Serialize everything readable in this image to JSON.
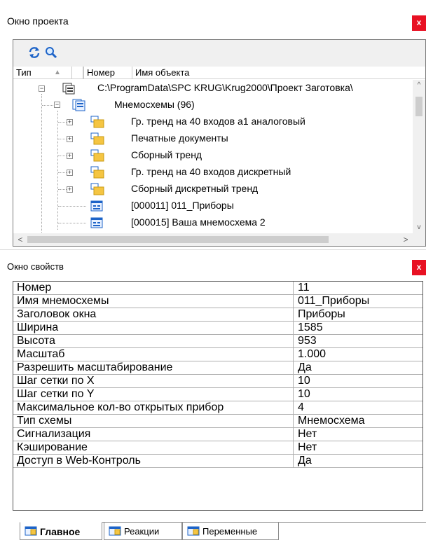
{
  "project_window": {
    "title": "Окно проекта",
    "close_label": "x",
    "columns": {
      "type": "Тип",
      "number": "Номер",
      "name": "Имя объекта"
    },
    "tree": {
      "root": {
        "label": "C:\\ProgramData\\SPC KRUG\\Krug2000\\Проект Заготовка\\"
      },
      "group": {
        "label": "Мнемосхемы (96)"
      },
      "folders": [
        {
          "label": "Гр. тренд на 40 входов а1 аналоговый"
        },
        {
          "label": "Печатные документы"
        },
        {
          "label": "Сборный тренд"
        },
        {
          "label": "Гр. тренд на 40 входов дискретный"
        },
        {
          "label": "Сборный дискретный тренд"
        }
      ],
      "items": [
        {
          "label": "[000011] 011_Приборы"
        },
        {
          "label": "[000015] Ваша мнемосхема 2"
        }
      ]
    },
    "scroll_up": "^",
    "scroll_down": "v",
    "scroll_left": "<",
    "scroll_right": ">"
  },
  "properties_window": {
    "title": "Окно свойств",
    "close_label": "x",
    "rows": [
      {
        "key": "Номер",
        "value": "11"
      },
      {
        "key": "Имя мнемосхемы",
        "value": "011_Приборы"
      },
      {
        "key": "Заголовок окна",
        "value": "Приборы"
      },
      {
        "key": "Ширина",
        "value": "1585"
      },
      {
        "key": "Высота",
        "value": "953"
      },
      {
        "key": "Масштаб",
        "value": "1.000"
      },
      {
        "key": "Разрешить масштабирование",
        "value": "Да"
      },
      {
        "key": "Шаг сетки по X",
        "value": "10"
      },
      {
        "key": "Шаг сетки по Y",
        "value": "10"
      },
      {
        "key": "Максимальное кол-во открытых прибор",
        "value": "4"
      },
      {
        "key": "Тип схемы",
        "value": "Мнемосхема"
      },
      {
        "key": "Сигнализация",
        "value": "Нет"
      },
      {
        "key": "Кэширование",
        "value": "Нет"
      },
      {
        "key": "Доступ в Web-Контроль",
        "value": "Да"
      }
    ],
    "tabs": [
      {
        "label": "Главное",
        "active": true
      },
      {
        "label": "Реакции",
        "active": false
      },
      {
        "label": "Переменные",
        "active": false
      }
    ]
  }
}
